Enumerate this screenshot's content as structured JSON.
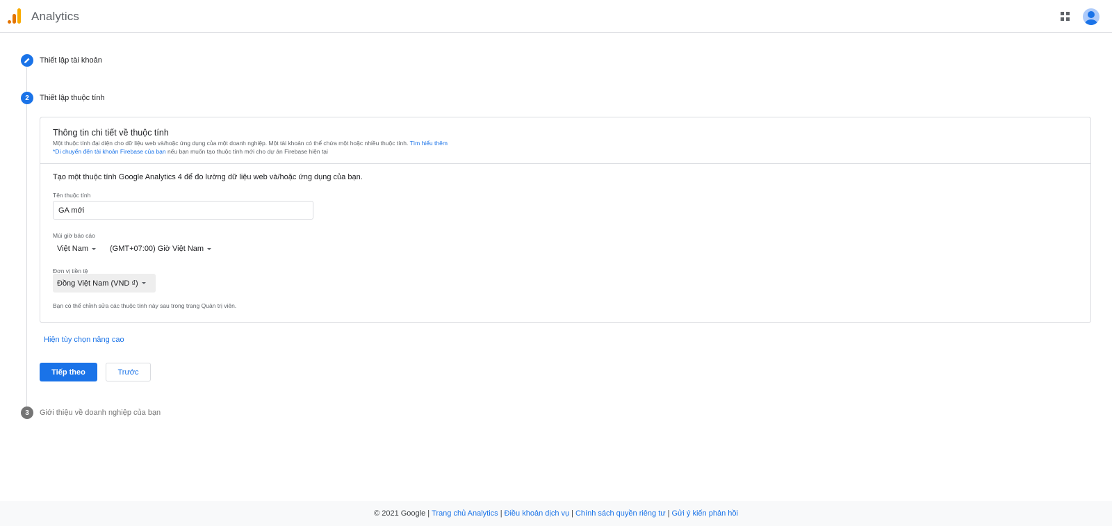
{
  "header": {
    "app_title": "Analytics",
    "logo_icon": "analytics-logo-icon",
    "apps_icon": "apps-grid-icon",
    "avatar_icon": "account-avatar-icon"
  },
  "stepper": {
    "step1": {
      "title": "Thiết lập tài khoản",
      "icon": "pencil-edit-icon"
    },
    "step2": {
      "number": "2",
      "title": "Thiết lập thuộc tính"
    },
    "step3": {
      "number": "3",
      "title": "Giới thiệu về doanh nghiệp của bạn"
    }
  },
  "property_card": {
    "title": "Thông tin chi tiết về thuộc tính",
    "description": "Một thuộc tính đại diện cho dữ liệu web và/hoặc ứng dụng của một doanh nghiệp. Một tài khoản có thể chứa một hoặc nhiều thuộc tính.",
    "learn_more": "Tìm hiểu thêm",
    "firebase_link": "*Di chuyển đến tài khoản Firebase của bạn",
    "firebase_note": "nếu bạn muốn tạo thuộc tính mới cho dự án Firebase hiện tại",
    "intro": "Tạo một thuộc tính Google Analytics 4 để đo lường dữ liệu web và/hoặc ứng dụng của bạn.",
    "property_name_label": "Tên thuộc tính",
    "property_name_value": "GA mới",
    "timezone_label": "Múi giờ báo cáo",
    "country_value": "Việt Nam",
    "timezone_value": "(GMT+07:00) Giờ Việt Nam",
    "currency_label": "Đơn vị tiền tệ",
    "currency_value": "Đồng Việt Nam (VND ₫)",
    "footnote": "Bạn có thể chỉnh sửa các thuộc tính này sau trong trang Quản trị viên."
  },
  "advanced_link": "Hiện tùy chọn nâng cao",
  "buttons": {
    "next": "Tiếp theo",
    "back": "Trước"
  },
  "footer": {
    "copyright": "© 2021 Google",
    "links": [
      "Trang chủ Analytics",
      "Điều khoản dịch vụ",
      "Chính sách quyền riêng tư",
      "Gửi ý kiến phản hồi"
    ],
    "separator": "|"
  },
  "colors": {
    "accent": "#1a73e8",
    "logo_orange": "#f9ab00",
    "logo_dark_orange": "#e37400"
  }
}
